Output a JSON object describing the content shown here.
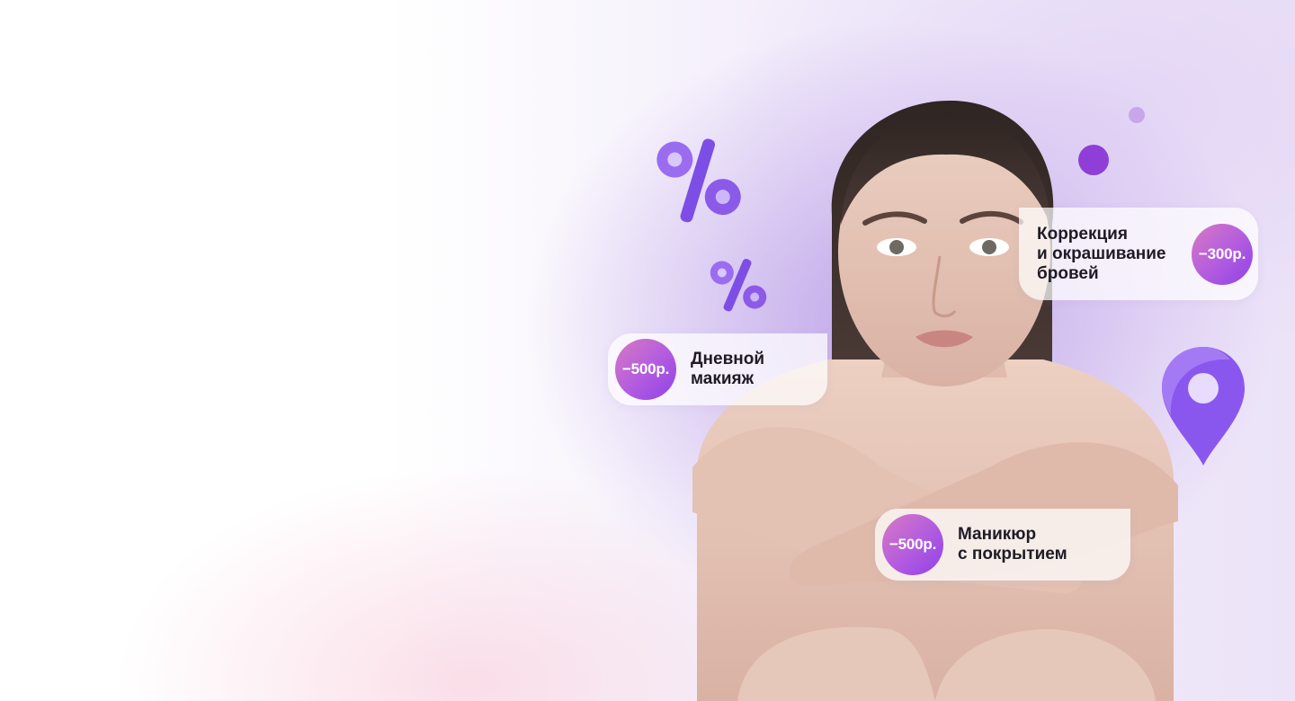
{
  "promos": [
    {
      "discount": "−500р.",
      "label": "Дневной\nмакияж"
    },
    {
      "discount": "−300р.",
      "label": "Коррекция\nи окрашивание\nбровей"
    },
    {
      "discount": "−500р.",
      "label": "Маникюр\nс покрытием"
    }
  ],
  "decor_icons": [
    "percent-3d-icon",
    "percent-3d-icon",
    "map-pin-3d-icon"
  ],
  "colors": {
    "accent_purple": "#8f3fd8",
    "badge_gradient_start": "#d77ac2",
    "badge_gradient_end": "#8e42e6",
    "background_lilac": "#ad8ce2",
    "background_pink": "#f8cddc"
  }
}
